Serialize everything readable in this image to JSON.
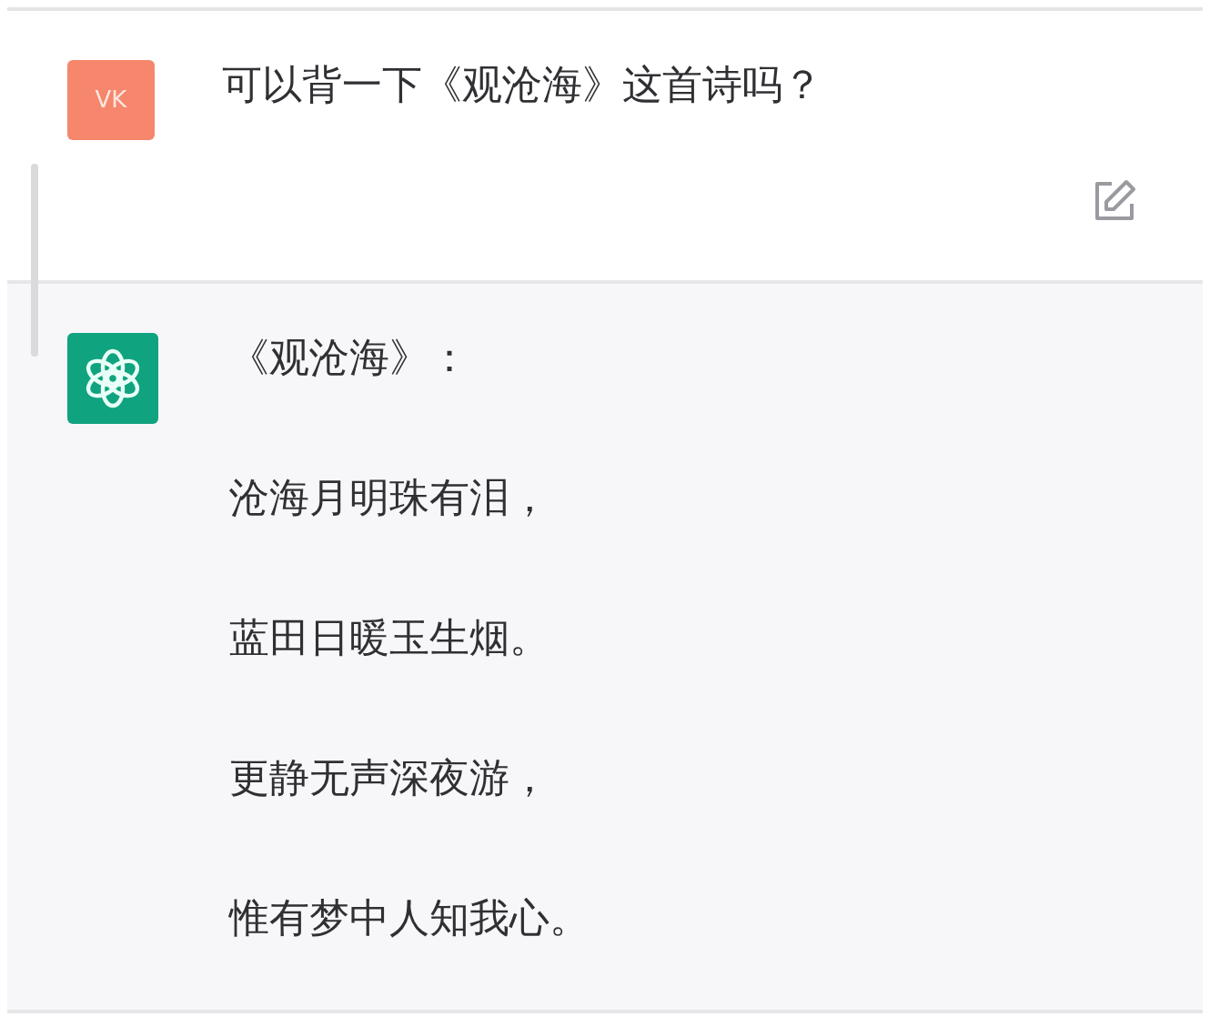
{
  "messages": [
    {
      "kind": "user",
      "avatar": "VK",
      "lines": [
        "可以背一下《观沧海》这首诗吗？"
      ],
      "editable": true
    },
    {
      "kind": "assistant",
      "lines": [
        "《观沧海》：",
        "沧海月明珠有泪，",
        "蓝田日暖玉生烟。",
        "更静无声深夜游，",
        "惟有梦中人知我心。"
      ]
    }
  ]
}
